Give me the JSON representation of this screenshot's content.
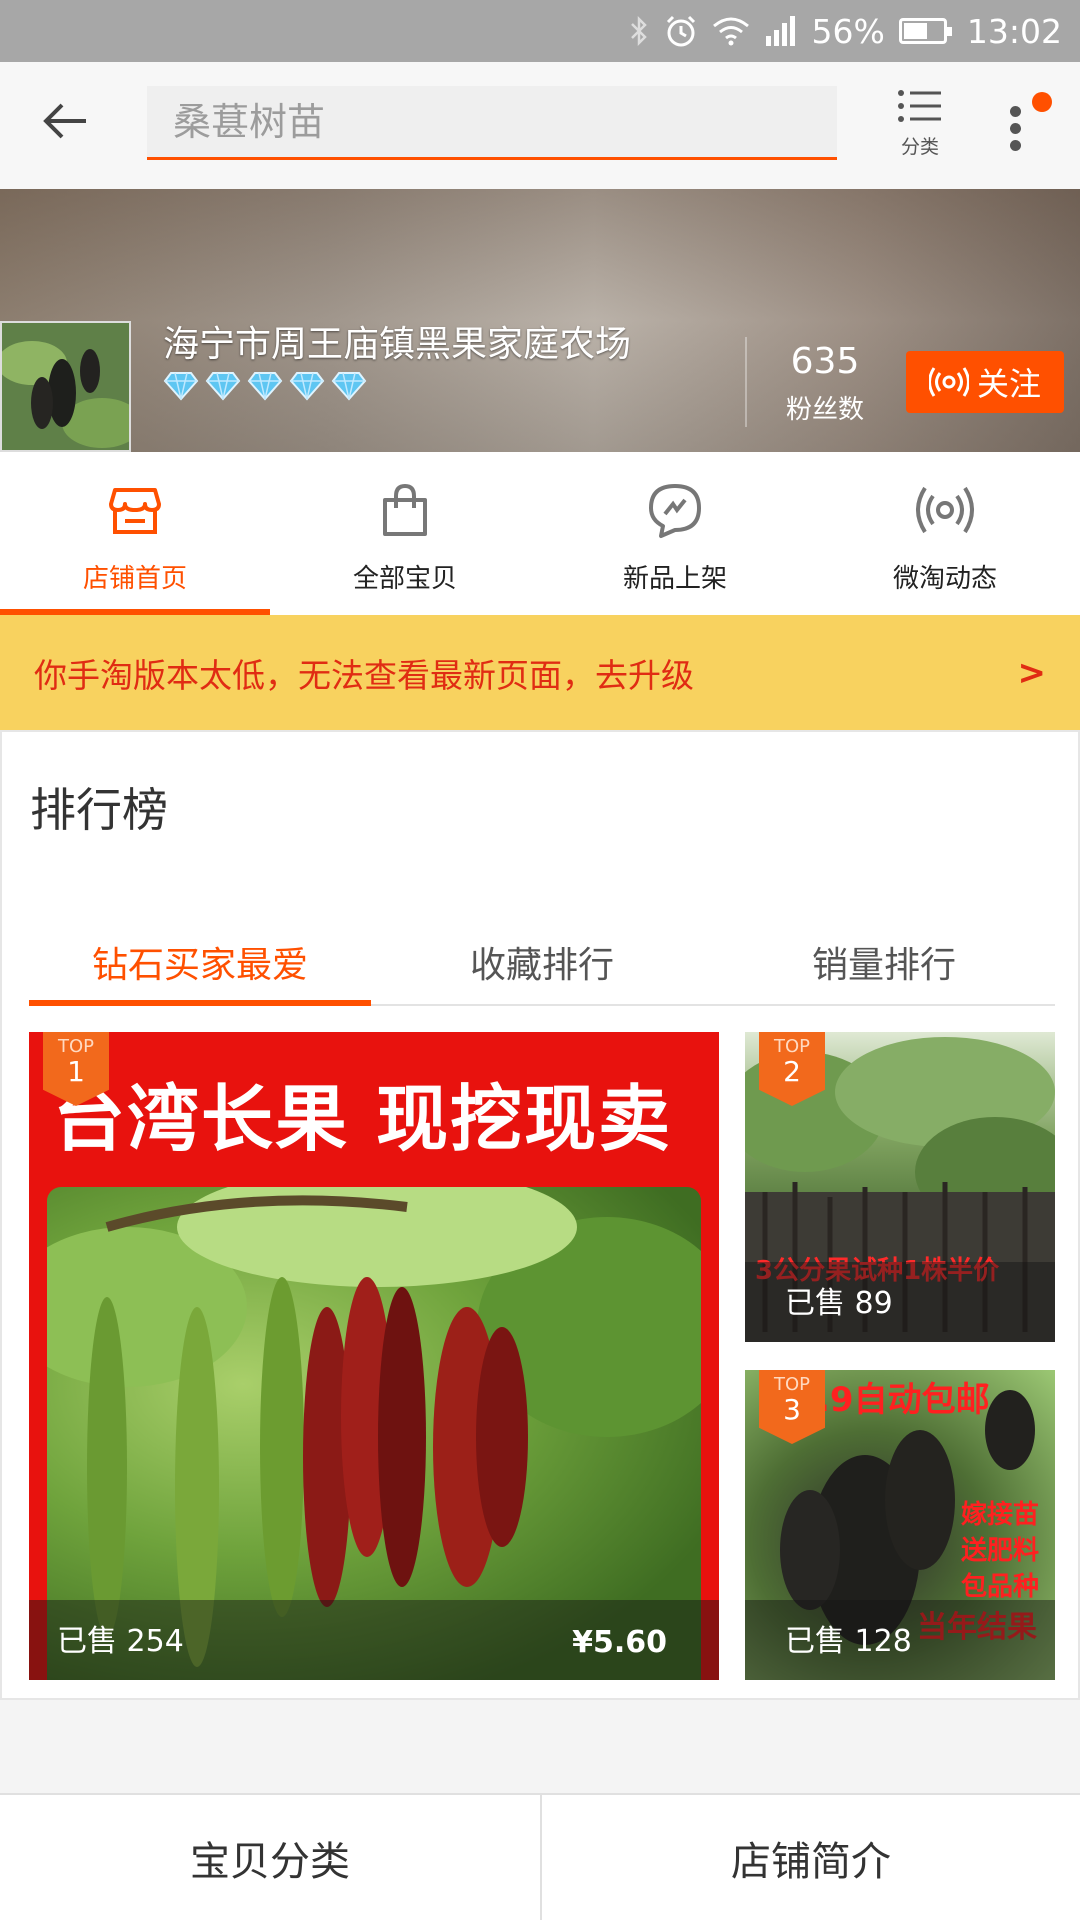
{
  "status_bar": {
    "battery": "56%",
    "time": "13:02"
  },
  "header": {
    "search_placeholder": "桑葚树苗",
    "category_label": "分类"
  },
  "shop": {
    "name": "海宁市周王庙镇黑果家庭农场",
    "diamond_count": 5,
    "fans_count": "635",
    "fans_label": "粉丝数",
    "follow_label": "关注"
  },
  "tabs": [
    {
      "label": "店铺首页",
      "icon": "shop-icon",
      "active": true
    },
    {
      "label": "全部宝贝",
      "icon": "bag-icon",
      "active": false
    },
    {
      "label": "新品上架",
      "icon": "chat-bolt-icon",
      "active": false
    },
    {
      "label": "微淘动态",
      "icon": "broadcast-icon",
      "active": false
    }
  ],
  "notice": {
    "text": "你手淘版本太低，无法查看最新页面，去升级",
    "arrow": ">"
  },
  "ranking": {
    "title": "排行榜",
    "tabs": [
      "钻石买家最爱",
      "收藏排行",
      "销量排行"
    ],
    "active_tab": 0,
    "products": [
      {
        "rank_label": "TOP",
        "rank": "1",
        "headline": "台湾长果 现挖现卖",
        "sold": "已售 254",
        "price": "¥5.60"
      },
      {
        "rank_label": "TOP",
        "rank": "2",
        "image_text": "3公分果试种1株半价",
        "sold": "已售 89"
      },
      {
        "rank_label": "TOP",
        "rank": "3",
        "image_text_top": ".9自动包邮",
        "image_text_lines": [
          "嫁接苗",
          "送肥料",
          "包品种",
          "当年结果"
        ],
        "sold": "已售 128"
      }
    ]
  },
  "bottom_bar": {
    "left": "宝贝分类",
    "right": "店铺简介"
  },
  "colors": {
    "accent": "#ff5000",
    "notice_bg": "#f8d25f",
    "notice_text": "#e02c13"
  }
}
